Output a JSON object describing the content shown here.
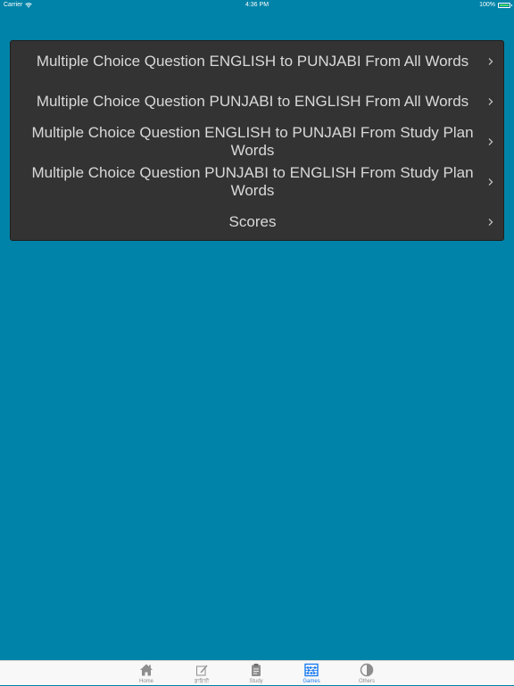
{
  "status_bar": {
    "carrier": "Carrier",
    "time": "4:36 PM",
    "battery": "100%",
    "battery_color": "#4cd964"
  },
  "theme": {
    "background": "#0083a8",
    "panel": "#333333",
    "menu_text": "#d9d9d9",
    "tab_active": "#1b7cf2",
    "tab_inactive": "#8e8e8e"
  },
  "menu": {
    "items": [
      {
        "label": "Multiple Choice Question ENGLISH to PUNJABI From All Words"
      },
      {
        "label": "Multiple Choice Question PUNJABI to ENGLISH From All Words"
      },
      {
        "label": "Multiple Choice Question ENGLISH to PUNJABI From Study Plan Words"
      },
      {
        "label": "Multiple Choice Question PUNJABI to ENGLISH From Study Plan Words"
      },
      {
        "label": "Scores"
      }
    ],
    "chevron_icon": "chevron-right-icon"
  },
  "tab_bar": {
    "tabs": [
      {
        "label": "Home",
        "icon": "home-icon",
        "active": false
      },
      {
        "label": "ਡਾਇਰੀ",
        "icon": "edit-icon",
        "active": false
      },
      {
        "label": "Study",
        "icon": "clipboard-icon",
        "active": false
      },
      {
        "label": "Games",
        "icon": "abacus-icon",
        "active": true
      },
      {
        "label": "Others",
        "icon": "half-circle-icon",
        "active": false
      }
    ]
  }
}
